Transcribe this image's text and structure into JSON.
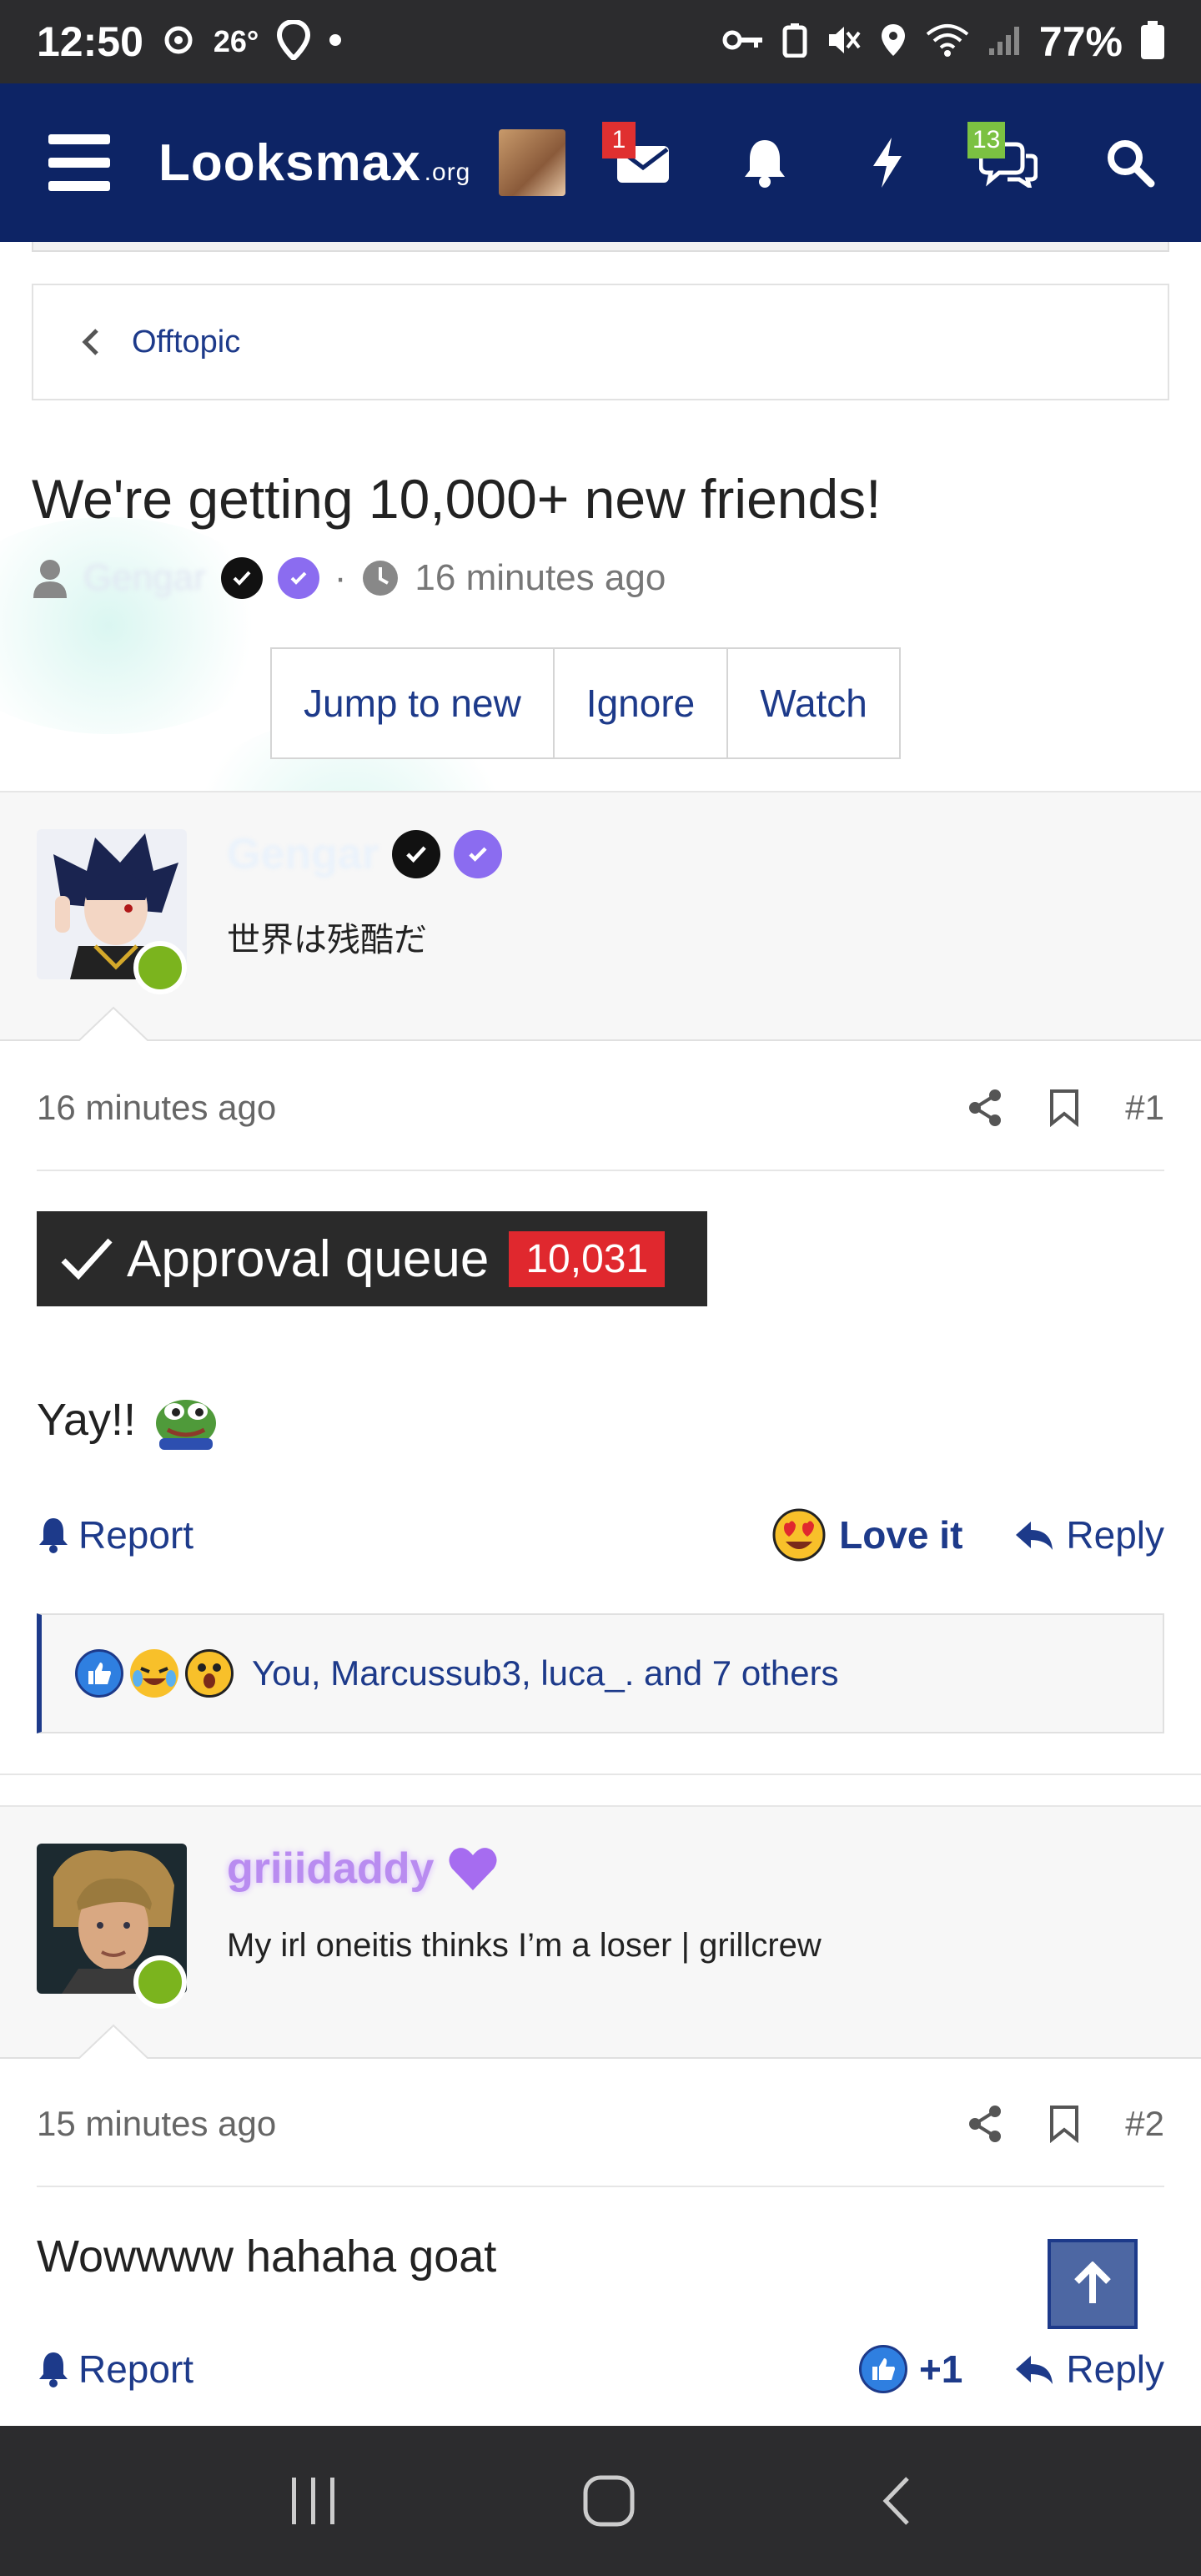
{
  "status_bar": {
    "time": "12:50",
    "temperature": "26°",
    "battery": "77%"
  },
  "nav": {
    "logo_main": "Looksmax",
    "logo_suffix": ".org",
    "inbox_badge": "1",
    "alerts_badge": "13"
  },
  "breadcrumb": {
    "label": "Offtopic"
  },
  "thread": {
    "title": "We're getting 10,000+ new friends!",
    "author": "Gengar",
    "separator": "·",
    "time": "16 minutes ago",
    "actions": [
      "Jump to new",
      "Ignore",
      "Watch"
    ]
  },
  "posts": [
    {
      "username": "Gengar",
      "user_title": "世界は残酷だ",
      "time": "16 minutes ago",
      "number": "#1",
      "approval_label": "Approval queue",
      "approval_count": "10,031",
      "text": "Yay!!",
      "report": "Report",
      "reaction_label": "Love it",
      "reply": "Reply",
      "reactions_summary": "You, Marcussub3, luca_. and 7 others"
    },
    {
      "username": "griiidaddy",
      "user_title": "My irl oneitis thinks I’m a loser | grillcrew",
      "time": "15 minutes ago",
      "number": "#2",
      "text": "Wowwww hahaha goat",
      "report": "Report",
      "reaction_count": "+1",
      "reply": "Reply"
    }
  ],
  "colors": {
    "nav_bg": "#0d2465",
    "link": "#1d3a8a",
    "badge_red": "#e03030",
    "badge_green": "#7bc142",
    "approval_red": "#e0282e",
    "online": "#7bb41e",
    "verified_purple": "#8b6cf0"
  }
}
